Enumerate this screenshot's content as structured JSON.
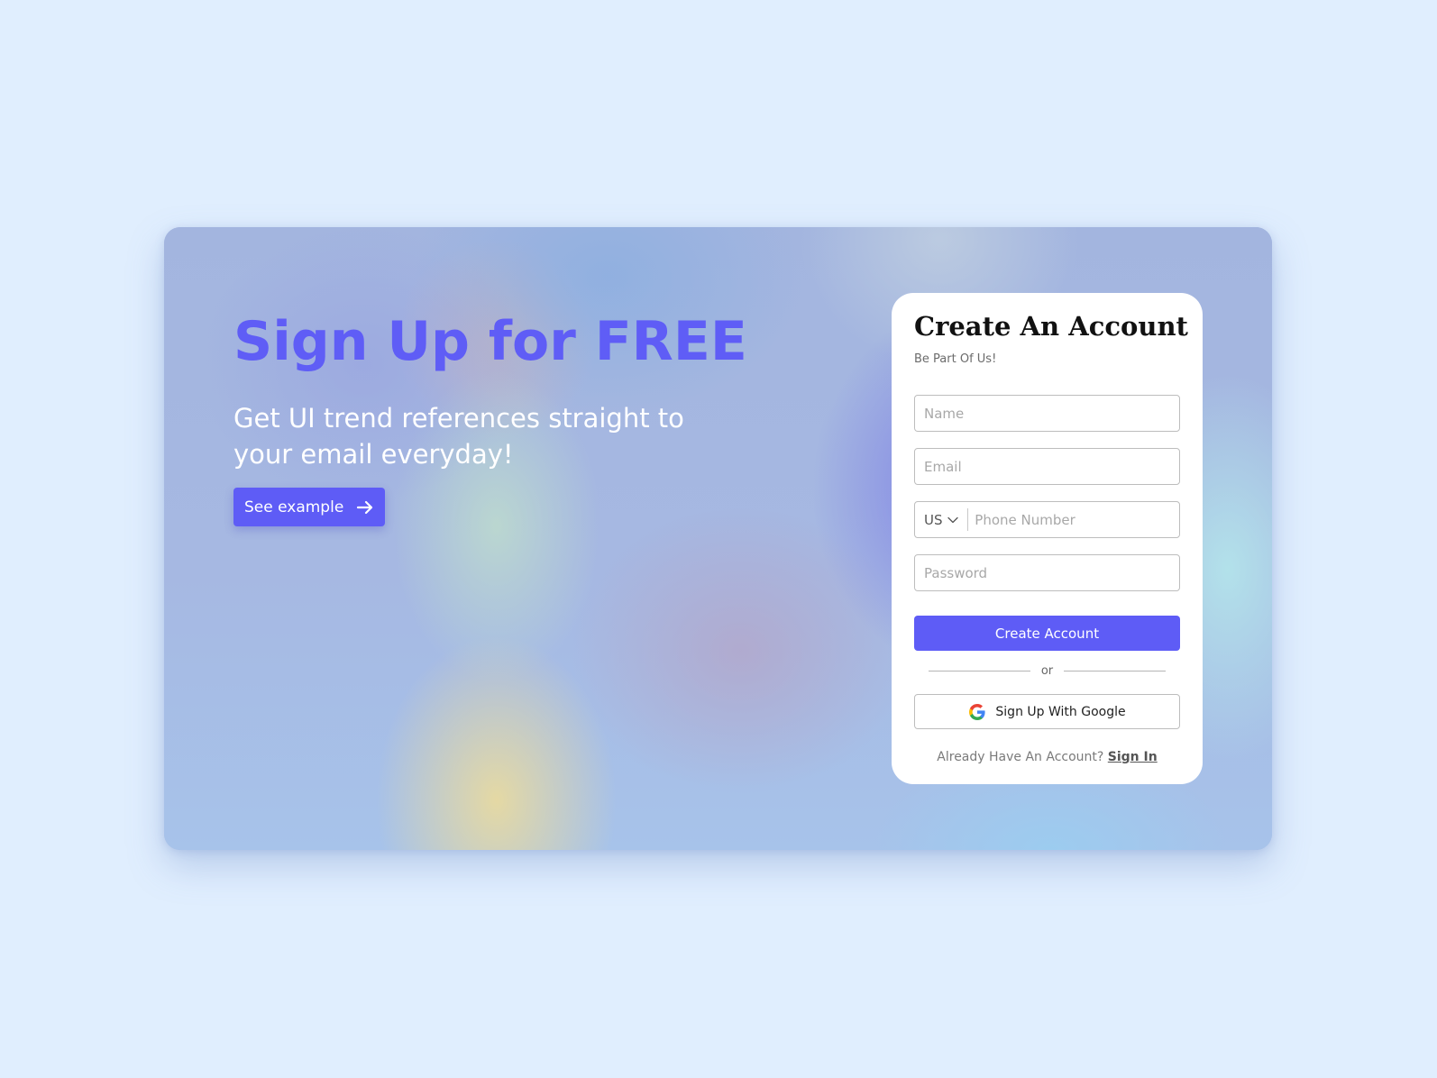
{
  "hero": {
    "title": "Sign Up for FREE",
    "subtitle": "Get UI trend references straight to your email everyday!",
    "cta_label": "See example",
    "cta_icon": "arrow-right-icon"
  },
  "form": {
    "title": "Create An Account",
    "subtitle": "Be Part Of Us!",
    "name_placeholder": "Name",
    "email_placeholder": "Email",
    "country_code": "US",
    "phone_placeholder": "Phone Number",
    "password_placeholder": "Password",
    "submit_label": "Create Account",
    "divider_text": "or",
    "google_label": "Sign Up With Google",
    "google_icon": "google-icon",
    "signin_prompt": "Already Have An Account?",
    "signin_link": "Sign In"
  },
  "colors": {
    "page_background": "#e0eefe",
    "accent": "#5e5cf6",
    "card_background": "#ffffff"
  }
}
